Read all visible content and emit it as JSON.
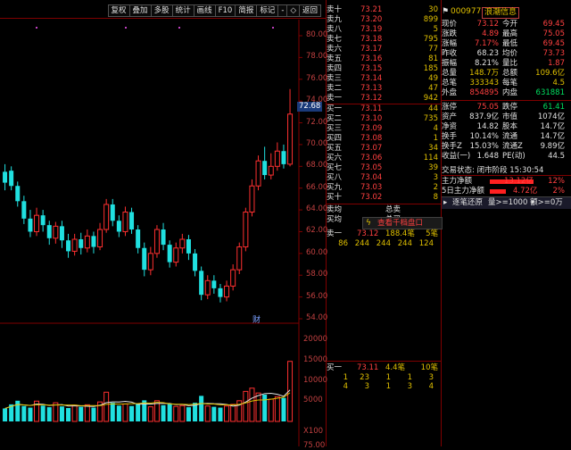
{
  "toolbar": {
    "buttons": [
      "复权",
      "叠加",
      "多股",
      "统计",
      "画线",
      "F10",
      "简报",
      "标记",
      "-",
      "◇",
      "返回"
    ]
  },
  "chart": {
    "y_axis_labels": [
      "80.00",
      "78.00",
      "76.00",
      "74.00",
      "72.00",
      "70.00",
      "68.00",
      "66.00",
      "64.00",
      "62.00",
      "60.00",
      "58.00",
      "56.00",
      "54.00"
    ],
    "current_price_tag": "72.68",
    "fin_badge": "财",
    "volume_axis_labels": [
      "20000",
      "15000",
      "10000",
      "5000",
      "X100"
    ],
    "bottom_partial_label": "75.00",
    "candles": [
      {
        "o": 66.5,
        "c": 67.5,
        "h": 68.2,
        "l": 65.8,
        "up": false
      },
      {
        "o": 67.6,
        "c": 66.2,
        "h": 68.0,
        "l": 65.8,
        "up": false
      },
      {
        "o": 66.2,
        "c": 64.8,
        "h": 66.6,
        "l": 64.3,
        "up": false
      },
      {
        "o": 64.8,
        "c": 63.2,
        "h": 65.3,
        "l": 62.7,
        "up": false
      },
      {
        "o": 63.2,
        "c": 62.0,
        "h": 64.0,
        "l": 61.5,
        "up": false
      },
      {
        "o": 62.0,
        "c": 63.5,
        "h": 64.2,
        "l": 61.6,
        "up": true
      },
      {
        "o": 63.5,
        "c": 62.6,
        "h": 64.0,
        "l": 62.0,
        "up": false
      },
      {
        "o": 62.6,
        "c": 61.4,
        "h": 63.0,
        "l": 60.8,
        "up": false
      },
      {
        "o": 61.4,
        "c": 62.5,
        "h": 62.9,
        "l": 60.9,
        "up": true
      },
      {
        "o": 62.5,
        "c": 61.2,
        "h": 63.0,
        "l": 60.5,
        "up": false
      },
      {
        "o": 61.2,
        "c": 60.2,
        "h": 61.8,
        "l": 59.6,
        "up": false
      },
      {
        "o": 60.2,
        "c": 61.3,
        "h": 61.8,
        "l": 59.8,
        "up": true
      },
      {
        "o": 61.3,
        "c": 60.5,
        "h": 61.9,
        "l": 59.9,
        "up": false
      },
      {
        "o": 60.5,
        "c": 61.6,
        "h": 62.2,
        "l": 60.1,
        "up": true
      },
      {
        "o": 61.6,
        "c": 60.6,
        "h": 62.0,
        "l": 60.0,
        "up": false
      },
      {
        "o": 60.6,
        "c": 62.2,
        "h": 62.8,
        "l": 60.3,
        "up": true
      },
      {
        "o": 62.2,
        "c": 64.5,
        "h": 65.0,
        "l": 61.9,
        "up": true
      },
      {
        "o": 64.5,
        "c": 63.0,
        "h": 65.0,
        "l": 62.5,
        "up": false
      },
      {
        "o": 63.0,
        "c": 62.0,
        "h": 63.5,
        "l": 61.5,
        "up": false
      },
      {
        "o": 62.0,
        "c": 63.8,
        "h": 64.3,
        "l": 61.6,
        "up": true
      },
      {
        "o": 63.8,
        "c": 62.2,
        "h": 64.2,
        "l": 61.8,
        "up": false
      },
      {
        "o": 62.2,
        "c": 60.5,
        "h": 62.6,
        "l": 60.0,
        "up": false
      },
      {
        "o": 60.5,
        "c": 58.5,
        "h": 61.0,
        "l": 57.9,
        "up": false
      },
      {
        "o": 58.5,
        "c": 60.0,
        "h": 60.6,
        "l": 58.0,
        "up": true
      },
      {
        "o": 60.0,
        "c": 62.2,
        "h": 62.6,
        "l": 59.6,
        "up": true
      },
      {
        "o": 62.2,
        "c": 60.8,
        "h": 62.8,
        "l": 60.3,
        "up": false
      },
      {
        "o": 60.8,
        "c": 59.2,
        "h": 61.2,
        "l": 58.7,
        "up": false
      },
      {
        "o": 59.2,
        "c": 60.5,
        "h": 61.0,
        "l": 58.8,
        "up": true
      },
      {
        "o": 60.5,
        "c": 61.3,
        "h": 61.8,
        "l": 60.0,
        "up": true
      },
      {
        "o": 61.3,
        "c": 60.0,
        "h": 61.7,
        "l": 59.4,
        "up": false
      },
      {
        "o": 60.0,
        "c": 58.4,
        "h": 60.4,
        "l": 57.9,
        "up": false
      },
      {
        "o": 58.4,
        "c": 56.2,
        "h": 58.8,
        "l": 55.7,
        "up": false
      },
      {
        "o": 56.2,
        "c": 57.5,
        "h": 58.0,
        "l": 55.8,
        "up": true
      },
      {
        "o": 57.5,
        "c": 56.8,
        "h": 58.0,
        "l": 56.3,
        "up": false
      },
      {
        "o": 56.8,
        "c": 56.0,
        "h": 57.2,
        "l": 55.5,
        "up": false
      },
      {
        "o": 56.0,
        "c": 57.0,
        "h": 57.5,
        "l": 55.6,
        "up": true
      },
      {
        "o": 57.0,
        "c": 58.5,
        "h": 59.0,
        "l": 56.6,
        "up": true
      },
      {
        "o": 58.5,
        "c": 60.6,
        "h": 61.0,
        "l": 58.1,
        "up": true
      },
      {
        "o": 60.6,
        "c": 63.8,
        "h": 64.2,
        "l": 60.2,
        "up": true
      },
      {
        "o": 63.8,
        "c": 66.2,
        "h": 66.8,
        "l": 63.4,
        "up": true
      },
      {
        "o": 66.2,
        "c": 68.5,
        "h": 69.0,
        "l": 65.8,
        "up": true
      },
      {
        "o": 68.5,
        "c": 67.2,
        "h": 69.8,
        "l": 66.8,
        "up": false
      },
      {
        "o": 67.2,
        "c": 68.0,
        "h": 69.2,
        "l": 66.8,
        "up": true
      },
      {
        "o": 68.0,
        "c": 69.4,
        "h": 70.2,
        "l": 67.6,
        "up": true
      },
      {
        "o": 69.4,
        "c": 68.2,
        "h": 70.0,
        "l": 67.8,
        "up": false
      },
      {
        "o": 68.2,
        "c": 72.8,
        "h": 75.1,
        "l": 68.0,
        "up": true
      }
    ],
    "volumes": [
      3200,
      4200,
      5100,
      3800,
      3400,
      5000,
      3900,
      3500,
      4600,
      3700,
      3300,
      4000,
      3600,
      4100,
      3400,
      4800,
      7200,
      4600,
      3900,
      4300,
      3800,
      4400,
      5200,
      3600,
      5100,
      4000,
      4300,
      3700,
      3900,
      3500,
      4600,
      6300,
      3800,
      3600,
      3400,
      3800,
      4200,
      5100,
      7400,
      8200,
      7000,
      6600,
      5500,
      6100,
      5800,
      14800
    ]
  },
  "order_book": {
    "sell": [
      {
        "label": "卖十",
        "price": "73.21",
        "vol": "30"
      },
      {
        "label": "卖九",
        "price": "73.20",
        "vol": "899"
      },
      {
        "label": "卖八",
        "price": "73.19",
        "vol": "5"
      },
      {
        "label": "卖七",
        "price": "73.18",
        "vol": "795"
      },
      {
        "label": "卖六",
        "price": "73.17",
        "vol": "77"
      },
      {
        "label": "卖五",
        "price": "73.16",
        "vol": "81"
      },
      {
        "label": "卖四",
        "price": "73.15",
        "vol": "185"
      },
      {
        "label": "卖三",
        "price": "73.14",
        "vol": "49"
      },
      {
        "label": "卖二",
        "price": "73.13",
        "vol": "47"
      },
      {
        "label": "卖一",
        "price": "73.12",
        "vol": "942"
      }
    ],
    "buy": [
      {
        "label": "买一",
        "price": "73.11",
        "vol": "44"
      },
      {
        "label": "买二",
        "price": "73.10",
        "vol": "735"
      },
      {
        "label": "买三",
        "price": "73.09",
        "vol": "4"
      },
      {
        "label": "买四",
        "price": "73.08",
        "vol": "1"
      },
      {
        "label": "买五",
        "price": "73.07",
        "vol": "34"
      },
      {
        "label": "买六",
        "price": "73.06",
        "vol": "114"
      },
      {
        "label": "买七",
        "price": "73.05",
        "vol": "39"
      },
      {
        "label": "买八",
        "price": "73.04",
        "vol": "3"
      },
      {
        "label": "买九",
        "price": "73.03",
        "vol": "2"
      },
      {
        "label": "买十",
        "price": "73.02",
        "vol": "8"
      }
    ],
    "avg_sell_label": "卖均",
    "avg_buy_label": "买均",
    "total_sell_label": "总卖",
    "total_buy_label": "总买",
    "view_queue_link": "查看千档盘口",
    "queue_sell": {
      "label": "卖一",
      "price": "73.12",
      "qty": "188.4笔",
      "count": "5笔"
    },
    "queue_sell_orders": [
      "86",
      "244",
      "244",
      "244",
      "124"
    ],
    "queue_buy": {
      "label": "买一",
      "price": "73.11",
      "qty": "4.4笔",
      "count": "10笔"
    },
    "queue_buy_orders_r1": [
      "1",
      "23",
      "1",
      "1",
      "3"
    ],
    "queue_buy_orders_r2": [
      "4",
      "3",
      "1",
      "3",
      "4"
    ]
  },
  "quote": {
    "code": "000977",
    "name": "浪潮信息",
    "rows": [
      {
        "l1": "现价",
        "v1": "73.12",
        "c1": "red",
        "l2": "今开",
        "v2": "69.45",
        "c2": "red"
      },
      {
        "l1": "涨跌",
        "v1": "4.89",
        "c1": "red",
        "l2": "最高",
        "v2": "75.05",
        "c2": "red"
      },
      {
        "l1": "涨幅",
        "v1": "7.17%",
        "c1": "red",
        "l2": "最低",
        "v2": "69.45",
        "c2": "red"
      },
      {
        "l1": "昨收",
        "v1": "68.23",
        "c1": "wht",
        "l2": "均价",
        "v2": "73.73",
        "c2": "red"
      },
      {
        "l1": "振幅",
        "v1": "8.21%",
        "c1": "wht",
        "l2": "量比",
        "v2": "1.87",
        "c2": "red"
      },
      {
        "l1": "总量",
        "v1": "148.7万",
        "c1": "yel",
        "l2": "总额",
        "v2": "109.6亿",
        "c2": "yel"
      },
      {
        "l1": "总笔",
        "v1": "333343",
        "c1": "yel",
        "l2": "每笔",
        "v2": "4.5",
        "c2": "yel"
      },
      {
        "l1": "外盘",
        "v1": "854895",
        "c1": "red",
        "l2": "内盘",
        "v2": "631881",
        "c2": "grn"
      }
    ],
    "rows2": [
      {
        "l1": "涨停",
        "v1": "75.05",
        "c1": "red",
        "l2": "跌停",
        "v2": "61.41",
        "c2": "grn"
      },
      {
        "l1": "资产",
        "v1": "837.9亿",
        "c1": "wht",
        "l2": "市值",
        "v2": "1074亿",
        "c2": "wht"
      },
      {
        "l1": "净资",
        "v1": "14.82",
        "c1": "wht",
        "l2": "股本",
        "v2": "14.7亿",
        "c2": "wht"
      },
      {
        "l1": "换手",
        "v1": "10.14%",
        "c1": "wht",
        "l2": "流通",
        "v2": "14.7亿",
        "c2": "wht"
      },
      {
        "l1": "换手Z",
        "v1": "15.03%",
        "c1": "wht",
        "l2": "流通Z",
        "v2": "9.89亿",
        "c2": "wht"
      },
      {
        "l1": "收益(一)",
        "v1": "1.648",
        "c1": "wht",
        "l2": "PE(动)",
        "v2": "44.5",
        "c2": "wht"
      }
    ],
    "trade_status": "交易状态: 闭市阶段 15:30:54",
    "main_flow_label": "主力净额",
    "main_flow_value": "13.12亿",
    "main_flow_pct": "12%",
    "main_flow_fill": 0.7,
    "flow5_label": "5日主力净额",
    "flow5_value": "4.72亿",
    "flow5_pct": "2%",
    "flow5_fill": 0.25,
    "tick_bar_label": "逐笔还原",
    "tick_filter": "量>=1000 额>=0万"
  }
}
